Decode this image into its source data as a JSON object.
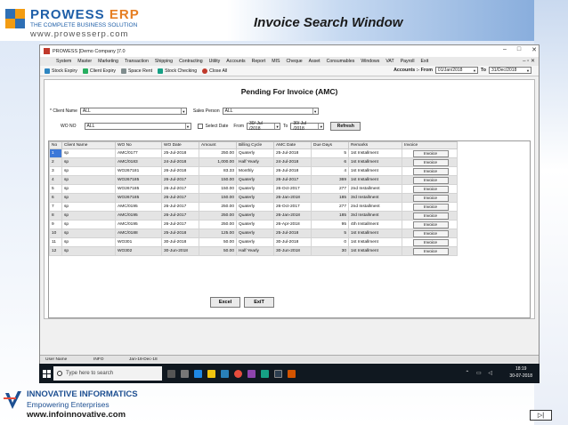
{
  "slide": {
    "title": "Invoice Search Window",
    "top_logo": {
      "brand_main": "PROWESS ",
      "brand_accent": "ERP",
      "tagline": "THE COMPLETE BUSINESS SOLUTION",
      "url": "www.prowesserp.com"
    },
    "bottom_logo": {
      "title": "INNOVATIVE INFORMATICS",
      "subtitle": "Empowering Enterprises",
      "url": "www.infoinnovative.com"
    },
    "nav_symbol": "▷|"
  },
  "window": {
    "title": "PROWESS [Demo Company ]7.0",
    "controls": {
      "minimize": "–",
      "maximize": "□",
      "close": "✕"
    },
    "menu": [
      "System",
      "Master",
      "Marketing",
      "Transaction",
      "Shipping",
      "Contracting",
      "Utility",
      "Accounts",
      "Report",
      "MIS",
      "Cheque",
      "Asset",
      "Consumables",
      "Windows",
      "VAT",
      "Payroll",
      "Exit"
    ],
    "menu_right": "– ▫ ✕",
    "toolbar": [
      {
        "label": "Stock Expiry",
        "icon": "stock-expiry-icon",
        "color": "#2e86c1"
      },
      {
        "label": "Client Expiry",
        "icon": "client-expiry-icon",
        "color": "#27ae60"
      },
      {
        "label": "Space Rent",
        "icon": "space-rent-icon",
        "color": "#7f8c8d"
      },
      {
        "label": "Stock Checking",
        "icon": "stock-checking-icon",
        "color": "#16a085"
      },
      {
        "label": "Close All",
        "icon": "close-all-icon",
        "color": "#c0392b"
      }
    ],
    "accounts_from_label": "Accounts :- From",
    "accounts_from": "01/Jan/2018",
    "accounts_to_label": "To",
    "accounts_to": "31/Dec/2018"
  },
  "form": {
    "page_title": "Pending For Invoice (AMC)",
    "client_name_label": "* Client Name",
    "client_name": "ALL",
    "sales_person_label": "Sales Person",
    "sales_person": "ALL",
    "wo_no_label": "WO NO",
    "wo_no": "ALL",
    "select_date_label": "Select Date",
    "from_label": "From",
    "from_date": "30/ Jul /2018",
    "to_label": "To",
    "to_date": "30/ Jul /2018",
    "refresh_label": "Refresh"
  },
  "grid": {
    "columns": [
      "No",
      "Client Name",
      "WO No",
      "WO Date",
      "Amount",
      "Billing Cycle",
      "AMC Date",
      "Due Days",
      "Remarks",
      "Invoice"
    ],
    "rows": [
      [
        "1",
        "sp",
        "AMC/0177",
        "25-Jul-2018",
        "250.00",
        "Quaterly",
        "25-Jul-2018",
        "5",
        "1st Installment",
        "Invoice"
      ],
      [
        "2",
        "sp",
        "AMC/0183",
        "24-Jul-2018",
        "1,000.00",
        "Half Yearly",
        "24-Jul-2018",
        "6",
        "1st Installment",
        "Invoice"
      ],
      [
        "3",
        "sp",
        "WO267181",
        "26-Jul-2018",
        "83.33",
        "Monthly",
        "26-Jul-2018",
        "4",
        "1st Installment",
        "Invoice"
      ],
      [
        "4",
        "sp",
        "WO267185",
        "26-Jul-2017",
        "150.00",
        "Quaterly",
        "26-Jul-2017",
        "369",
        "1st Installment",
        "Invoice"
      ],
      [
        "5",
        "sp",
        "WO267185",
        "26-Jul-2017",
        "150.00",
        "Quaterly",
        "26-Oct-2017",
        "277",
        "2nd Installment",
        "Invoice"
      ],
      [
        "6",
        "sp",
        "WO267185",
        "26-Jul-2017",
        "150.00",
        "Quaterly",
        "26-Jan-2018",
        "185",
        "3rd Installment",
        "Invoice"
      ],
      [
        "7",
        "sp",
        "AMC/0195",
        "26-Jul-2017",
        "250.00",
        "Quaterly",
        "26-Oct-2017",
        "277",
        "2nd Installment",
        "Invoice"
      ],
      [
        "8",
        "sp",
        "AMC/0195",
        "26-Jul-2017",
        "250.00",
        "Quaterly",
        "26-Jan-2018",
        "185",
        "3rd Installment",
        "Invoice"
      ],
      [
        "9",
        "sp",
        "AMC/0195",
        "26-Jul-2017",
        "250.00",
        "Quaterly",
        "26-Apr-2018",
        "95",
        "4th Installment",
        "Invoice"
      ],
      [
        "10",
        "sp",
        "AMC/0188",
        "25-Jul-2018",
        "125.00",
        "Quaterly",
        "25-Jul-2018",
        "5",
        "1st Installment",
        "Invoice"
      ],
      [
        "11",
        "sp",
        "WO301",
        "30-Jul-2018",
        "50.00",
        "Quaterly",
        "30-Jul-2018",
        "0",
        "1st Installment",
        "Invoice"
      ],
      [
        "12",
        "sp",
        "WO302",
        "30-Jun-2018",
        "50.00",
        "Half Yearly",
        "30-Jun-2018",
        "30",
        "1st Installment",
        "Invoice"
      ]
    ]
  },
  "buttons": {
    "excel": "Excel",
    "exit": "ExiT"
  },
  "status": {
    "user_name": "User Name",
    "info": "INFO",
    "date": "Jan-18-Dec-18"
  },
  "taskbar": {
    "search_placeholder": "Type here to search",
    "time": "18:19",
    "date": "30-07-2018"
  }
}
